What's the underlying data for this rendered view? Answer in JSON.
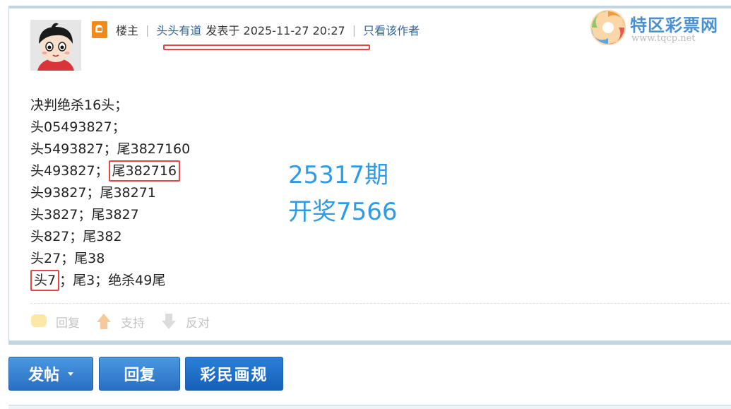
{
  "post": {
    "floor_label": "楼主",
    "author": "头头有道",
    "posted_at": "发表于 2025-11-27 20:27",
    "only_author_link": "只看该作者",
    "separator": "|"
  },
  "logo": {
    "name": "特区彩票网",
    "url": "www.tqcp.net"
  },
  "content": {
    "lines": [
      "决判绝杀16头；",
      "头05493827；",
      "头5493827；尾3827160",
      "头493827；",
      "尾382716",
      "头93827；尾38271",
      "头3827；尾3827",
      "头827；尾382",
      "头27；尾38",
      "头7",
      "；尾3；绝杀49尾"
    ]
  },
  "draw_info": {
    "issue": "25317期",
    "result": "开奖7566"
  },
  "actions": {
    "reply": "回复",
    "support": "支持",
    "oppose": "反对"
  },
  "buttons": {
    "post": "发帖",
    "reply": "回复",
    "rules": "彩民画规"
  },
  "colors": {
    "accent_blue": "#2e9be6",
    "link_blue": "#336699",
    "highlight_red": "#e64545",
    "border_blue": "#c2d5e3"
  }
}
